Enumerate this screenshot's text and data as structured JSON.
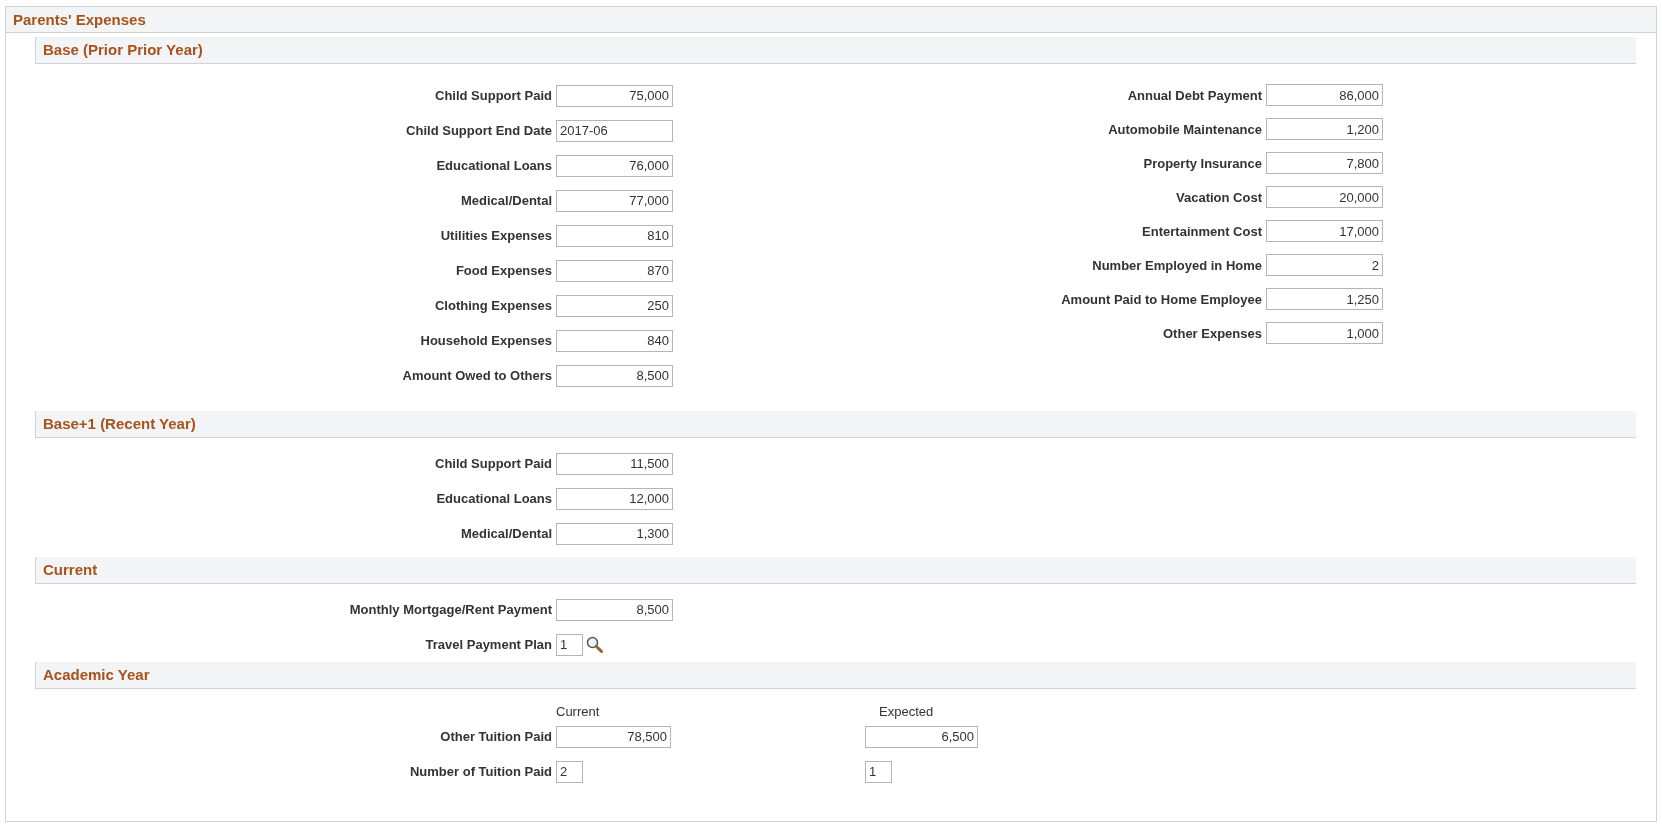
{
  "page": {
    "title": "Parents' Expenses"
  },
  "sections": [
    {
      "title": "Base (Prior Prior Year)",
      "kind": "form",
      "columns": [
        [
          {
            "label": "Child Support Paid",
            "value": "75,000",
            "kind": "amount"
          },
          {
            "label": "Child Support End Date",
            "value": "2017-06",
            "kind": "text"
          },
          {
            "label": "Educational Loans",
            "value": "76,000",
            "kind": "amount"
          },
          {
            "label": "Medical/Dental",
            "value": "77,000",
            "kind": "amount"
          },
          {
            "label": "Utilities Expenses",
            "value": "810",
            "kind": "amount"
          },
          {
            "label": "Food Expenses",
            "value": "870",
            "kind": "amount"
          },
          {
            "label": "Clothing Expenses",
            "value": "250",
            "kind": "amount"
          },
          {
            "label": "Household Expenses",
            "value": "840",
            "kind": "amount"
          },
          {
            "label": "Amount Owed to Others",
            "value": "8,500",
            "kind": "amount"
          }
        ],
        [
          {
            "label": "Annual Debt Payment",
            "value": "86,000",
            "kind": "amount"
          },
          {
            "label": "Automobile Maintenance",
            "value": "1,200",
            "kind": "amount"
          },
          {
            "label": "Property Insurance",
            "value": "7,800",
            "kind": "amount"
          },
          {
            "label": "Vacation Cost",
            "value": "20,000",
            "kind": "amount"
          },
          {
            "label": "Entertainment Cost",
            "value": "17,000",
            "kind": "amount"
          },
          {
            "label": "Number Employed in Home",
            "value": "2",
            "kind": "amount"
          },
          {
            "label": "Amount Paid to Home Employee",
            "value": "1,250",
            "kind": "amount"
          },
          {
            "label": "Other Expenses",
            "value": "1,000",
            "kind": "amount"
          }
        ]
      ]
    },
    {
      "title": "Base+1 (Recent Year)",
      "kind": "form",
      "columns": [
        [
          {
            "label": "Child Support Paid",
            "value": "11,500",
            "kind": "amount"
          },
          {
            "label": "Educational Loans",
            "value": "12,000",
            "kind": "amount"
          },
          {
            "label": "Medical/Dental",
            "value": "1,300",
            "kind": "amount"
          }
        ]
      ]
    },
    {
      "title": "Current",
      "kind": "form",
      "columns": [
        [
          {
            "label": "Monthly Mortgage/Rent Payment",
            "value": "8,500",
            "kind": "amount"
          },
          {
            "label": "Travel Payment Plan",
            "value": "1",
            "kind": "lookup"
          }
        ]
      ]
    },
    {
      "title": "Academic Year",
      "kind": "comparison",
      "headers": [
        "Current",
        "Expected"
      ],
      "rows": [
        {
          "label": "Other Tuition Paid",
          "kind": "amount",
          "values": [
            "78,500",
            "6,500"
          ]
        },
        {
          "label": "Number of Tuition Paid",
          "kind": "short",
          "values": [
            "2",
            "1"
          ]
        }
      ]
    }
  ]
}
